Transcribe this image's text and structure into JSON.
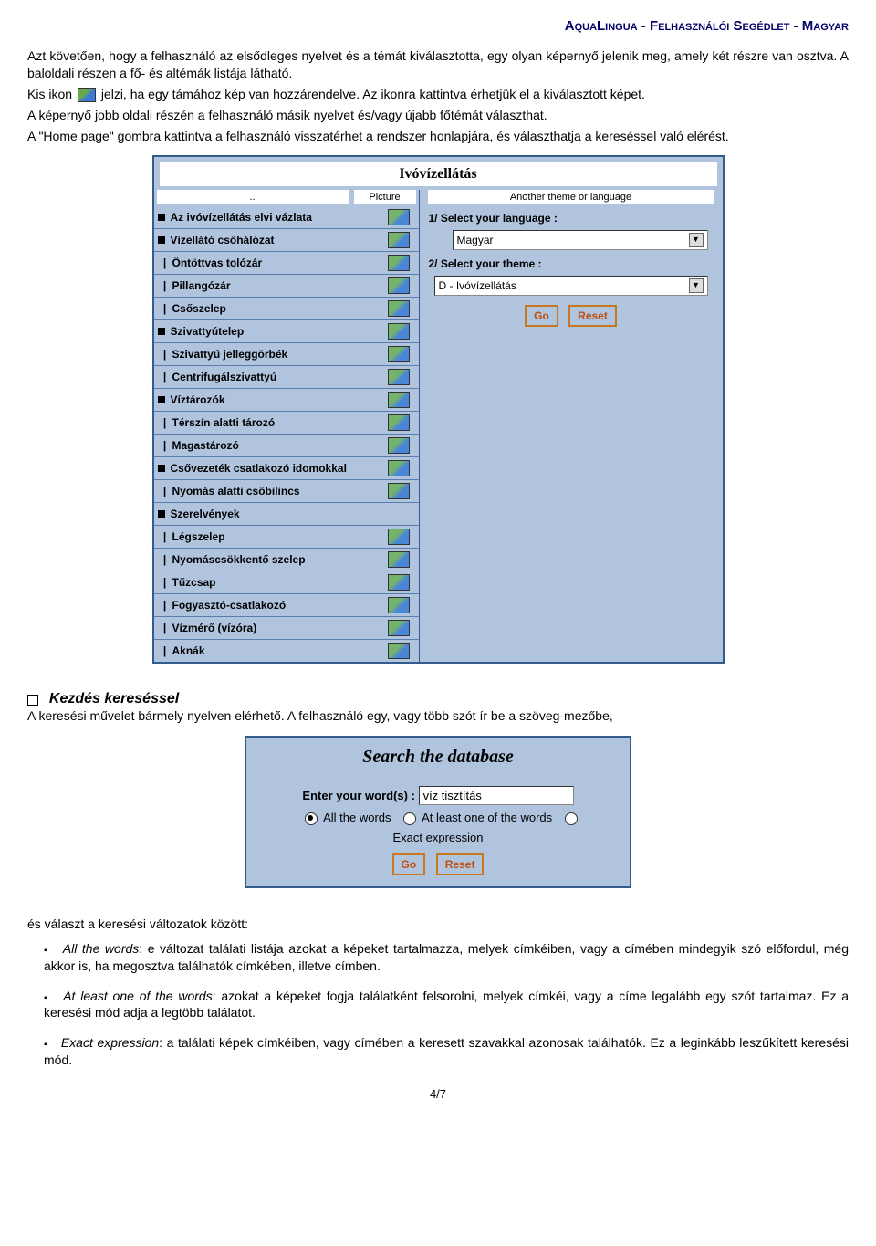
{
  "header": "AquaLingua - Felhasználói Segédlet - Magyar",
  "intro1": "Azt követően, hogy a felhasználó az elsődleges nyelvet és a témát kiválasztotta, egy olyan képernyő jelenik meg, amely két részre van osztva. A baloldali részen a fő- és altémák listája látható.",
  "intro2a": "Kis ikon ",
  "intro2b": " jelzi, ha egy támához kép van hozzárendelve. Az ikonra kattintva érhetjük el a kiválasztott képet.",
  "intro3": "A képernyő jobb oldali részén a felhasználó másik nyelvet és/vagy újabb főtémát választhat.",
  "intro4": "A \"Home page\" gombra kattintva a felhasználó visszatérhet a rendszer honlapjára, és választhatja a kereséssel való elérést.",
  "panel": {
    "title": "Ivóvízellátás",
    "leftHeaderDots": "..",
    "leftHeaderPic": "Picture",
    "rightHeader": "Another theme or language",
    "items": [
      {
        "t": "main",
        "label": "Az ivóvízellátás elvi vázlata",
        "icon": true
      },
      {
        "t": "main",
        "label": "Vízellátó csőhálózat",
        "icon": true
      },
      {
        "t": "sub",
        "label": "Öntöttvas tolózár",
        "icon": true
      },
      {
        "t": "sub",
        "label": "Pillangózár",
        "icon": true
      },
      {
        "t": "sub",
        "label": "Csőszelep",
        "icon": true
      },
      {
        "t": "main",
        "label": "Szivattyútelep",
        "icon": true
      },
      {
        "t": "sub",
        "label": "Szivattyú jelleggörbék",
        "icon": true
      },
      {
        "t": "sub",
        "label": "Centrifugálszivattyú",
        "icon": true
      },
      {
        "t": "main",
        "label": "Víztározók",
        "icon": true
      },
      {
        "t": "sub",
        "label": "Térszín alatti tározó",
        "icon": true
      },
      {
        "t": "sub",
        "label": "Magastározó",
        "icon": true
      },
      {
        "t": "main",
        "label": "Csővezeték csatlakozó idomokkal",
        "icon": true
      },
      {
        "t": "sub",
        "label": "Nyomás alatti csőbilincs",
        "icon": true
      },
      {
        "t": "main",
        "label": "Szerelvények",
        "icon": false
      },
      {
        "t": "sub",
        "label": "Légszelep",
        "icon": true
      },
      {
        "t": "sub",
        "label": "Nyomáscsökkentő szelep",
        "icon": true
      },
      {
        "t": "sub",
        "label": "Tűzcsap",
        "icon": true
      },
      {
        "t": "sub",
        "label": "Fogyasztó-csatlakozó",
        "icon": true
      },
      {
        "t": "sub",
        "label": "Vízmérő (vízóra)",
        "icon": true
      },
      {
        "t": "sub",
        "label": "Aknák",
        "icon": true
      }
    ],
    "rightLabel1": "1/ Select your language :",
    "langValue": "Magyar",
    "rightLabel2": "2/ Select your theme :",
    "themeValue": "D - Ivóvízellátás",
    "goBtn": "Go",
    "resetBtn": "Reset"
  },
  "section2": {
    "title": "Kezdés kereséssel",
    "line": "A keresési művelet bármely nyelven elérhető. A felhasználó egy, vagy több szót ír be a szöveg-mezőbe,"
  },
  "search": {
    "title": "Search the database",
    "enterLabel": "Enter your word(s) :",
    "inputValue": "víz tisztítás",
    "opt1": "All the words",
    "opt2": "At least one of the words",
    "opt3": "Exact expression",
    "goBtn": "Go",
    "resetBtn": "Reset"
  },
  "options": {
    "lead": "és választ a keresési változatok között:",
    "i1name": "All the words",
    "i1": ": e változat találati listája azokat a képeket tartalmazza, melyek címkéiben, vagy a címében mindegyik szó előfordul, még akkor is, ha megosztva találhatók címkében, illetve címben.",
    "i2name": "At least one of the words",
    "i2": ": azokat a képeket fogja találatként felsorolni, melyek címkéi, vagy a címe legalább egy szót tartalmaz. Ez a keresési mód adja a legtöbb találatot.",
    "i3name": "Exact expression",
    "i3": ": a találati képek címkéiben, vagy címében a keresett szavakkal azonosak találhatók. Ez a leginkább leszűkített keresési mód."
  },
  "pageNum": "4/7"
}
